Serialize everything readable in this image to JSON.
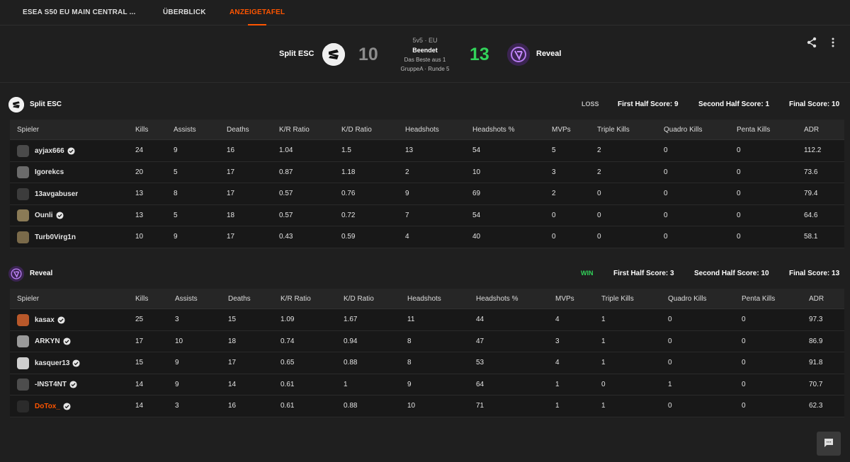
{
  "nav": {
    "tabs": [
      {
        "label": "ESEA S50 EU MAIN CENTRAL ..."
      },
      {
        "label": "ÜBERBLICK"
      },
      {
        "label": "ANZEIGETAFEL"
      }
    ]
  },
  "match": {
    "format": "5v5 · EU",
    "status": "Beendet",
    "best_of": "Das Beste aus 1",
    "round": "GruppeA · Runde 5",
    "team1": {
      "name": "Split ESC",
      "score": "10"
    },
    "team2": {
      "name": "Reveal",
      "score": "13"
    }
  },
  "columns": [
    "Spieler",
    "Kills",
    "Assists",
    "Deaths",
    "K/R Ratio",
    "K/D Ratio",
    "Headshots",
    "Headshots %",
    "MVPs",
    "Triple Kills",
    "Quadro Kills",
    "Penta Kills",
    "ADR"
  ],
  "teams": [
    {
      "name": "Split ESC",
      "result": "LOSS",
      "first_half": "First Half Score: 9",
      "second_half": "Second Half Score: 1",
      "final": "Final Score: 10",
      "players": [
        {
          "name": "ayjax666",
          "verified": true,
          "stats": [
            "24",
            "9",
            "16",
            "1.04",
            "1.5",
            "13",
            "54",
            "5",
            "2",
            "0",
            "0",
            "112.2"
          ]
        },
        {
          "name": "Igorekcs",
          "verified": false,
          "stats": [
            "20",
            "5",
            "17",
            "0.87",
            "1.18",
            "2",
            "10",
            "3",
            "2",
            "0",
            "0",
            "73.6"
          ]
        },
        {
          "name": "13avgabuser",
          "verified": false,
          "stats": [
            "13",
            "8",
            "17",
            "0.57",
            "0.76",
            "9",
            "69",
            "2",
            "0",
            "0",
            "0",
            "79.4"
          ]
        },
        {
          "name": "Ounli",
          "verified": true,
          "stats": [
            "13",
            "5",
            "18",
            "0.57",
            "0.72",
            "7",
            "54",
            "0",
            "0",
            "0",
            "0",
            "64.6"
          ]
        },
        {
          "name": "Turb0Virg1n",
          "verified": false,
          "stats": [
            "10",
            "9",
            "17",
            "0.43",
            "0.59",
            "4",
            "40",
            "0",
            "0",
            "0",
            "0",
            "58.1"
          ]
        }
      ]
    },
    {
      "name": "Reveal",
      "result": "WIN",
      "first_half": "First Half Score: 3",
      "second_half": "Second Half Score: 10",
      "final": "Final Score: 13",
      "players": [
        {
          "name": "kasax",
          "verified": true,
          "stats": [
            "25",
            "3",
            "15",
            "1.09",
            "1.67",
            "11",
            "44",
            "4",
            "1",
            "0",
            "0",
            "97.3"
          ]
        },
        {
          "name": "ARKYN",
          "verified": true,
          "stats": [
            "17",
            "10",
            "18",
            "0.74",
            "0.94",
            "8",
            "47",
            "3",
            "1",
            "0",
            "0",
            "86.9"
          ]
        },
        {
          "name": "kasquer13",
          "verified": true,
          "stats": [
            "15",
            "9",
            "17",
            "0.65",
            "0.88",
            "8",
            "53",
            "4",
            "1",
            "0",
            "0",
            "91.8"
          ]
        },
        {
          "name": "-INST4NT",
          "verified": true,
          "stats": [
            "14",
            "9",
            "14",
            "0.61",
            "1",
            "9",
            "64",
            "1",
            "0",
            "1",
            "0",
            "70.7"
          ]
        },
        {
          "name": "DoTox_",
          "verified": true,
          "highlight": true,
          "stats": [
            "14",
            "3",
            "16",
            "0.61",
            "0.88",
            "10",
            "71",
            "1",
            "1",
            "0",
            "0",
            "62.3"
          ]
        }
      ]
    }
  ],
  "colors": {
    "accent": "#ff5500",
    "win": "#32d35a",
    "loss_score": "#8c8c8c"
  },
  "icons": {
    "share": "share-icon",
    "more": "more-vertical-icon",
    "chat": "chat-icon",
    "verified": "verified-badge-icon"
  }
}
